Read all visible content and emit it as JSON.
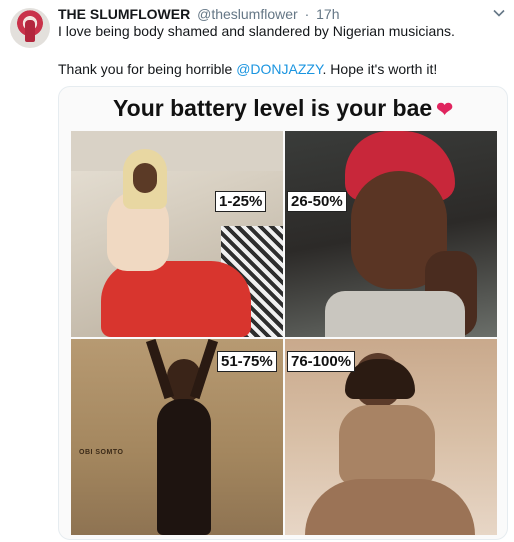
{
  "tweet": {
    "display_name": "THE SLUMFLOWER",
    "handle": "@theslumflower",
    "separator": "·",
    "time": "17h",
    "text_line1": "I love being body shamed and slandered by Nigerian musicians.",
    "text_line2_before": "Thank you for being horrible ",
    "mention": "@DONJAZZY",
    "text_line2_after": ". Hope it's worth it!"
  },
  "meme": {
    "title": "Your battery level is your bae",
    "heart": "❤",
    "labels": [
      "1-25%",
      "26-50%",
      "51-75%",
      "76-100%"
    ],
    "watermark": "OBI SOMTO"
  },
  "colors": {
    "link": "#1b95e0",
    "muted": "#657786",
    "heart": "#e0245e"
  },
  "icons": {
    "caret": "chevron-down-icon"
  }
}
